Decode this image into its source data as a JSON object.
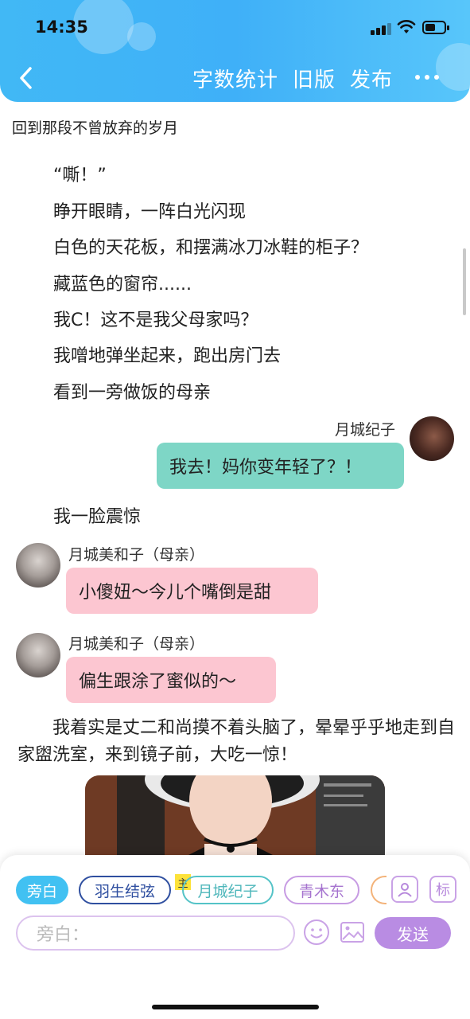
{
  "status": {
    "time": "14:35"
  },
  "navbar": {
    "word_count": "字数统计",
    "old_version": "旧版",
    "publish": "发布"
  },
  "story": {
    "title": "回到那段不曾放弃的岁月",
    "narration": [
      "“嘶！”",
      "睁开眼睛，一阵白光闪现",
      "白色的天花板，和摆满冰刀冰鞋的柜子？",
      "藏蓝色的窗帘......",
      "我C！这不是我父母家吗？",
      "我噌地弹坐起来，跑出房门去",
      "看到一旁做饭的母亲"
    ],
    "msg1": {
      "name": "月城纪子",
      "text": "我去！妈你变年轻了？！"
    },
    "narration2": "我一脸震惊",
    "msg2": {
      "name": "月城美和子（母亲）",
      "text": "小傻妞～今儿个嘴倒是甜"
    },
    "msg3": {
      "name": "月城美和子（母亲）",
      "text": "偏生跟涂了蜜似的～"
    },
    "paragraph": "我着实是丈二和尚摸不着头脑了，晕晕乎乎地走到自家盥洗室，来到镜子前，大吃一惊！"
  },
  "composer": {
    "chips": {
      "narrator": "旁白",
      "char_a": "羽生结弦",
      "char_b": "月城纪子",
      "char_c": "青木东"
    },
    "main_tag": "主",
    "tag_button": "标",
    "input_placeholder": "旁白：",
    "send": "发送"
  },
  "colors": {
    "header": "#41b8f5",
    "green_bubble": "#7ed6c6",
    "pink_bubble": "#fcc6d1",
    "send": "#b98ce3"
  }
}
